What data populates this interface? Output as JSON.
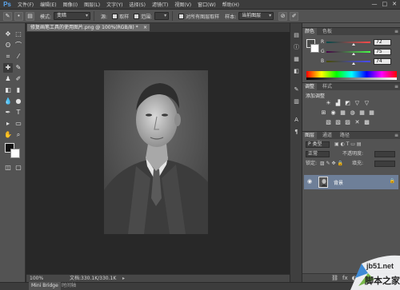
{
  "app": {
    "logo": "Ps"
  },
  "menubar": {
    "items": [
      "文件(F)",
      "编辑(E)",
      "图像(I)",
      "图层(L)",
      "文字(Y)",
      "选择(S)",
      "滤镜(T)",
      "视图(V)",
      "窗口(W)",
      "帮助(H)"
    ],
    "window_controls": [
      "—",
      "□",
      "✕"
    ]
  },
  "options": {
    "mode_label": "模式:",
    "mode_value": "变暗",
    "cancel_label": "取样",
    "range_label": "范围:",
    "protect_label": "对所有图层取样",
    "sample_label": "样本:",
    "sample_value": "当前图层"
  },
  "document": {
    "tab_title": "修复画笔工具的使用图片.png @ 100%(RGB/8) *",
    "close": "×"
  },
  "status": {
    "zoom": "100%",
    "doc_info": "文档:330.1K/330.1K"
  },
  "bottom": {
    "mini_bridge": "Mini Bridge",
    "timeline": "时间轴"
  },
  "color_panel": {
    "tabs": [
      "颜色",
      "色板"
    ],
    "menu": "≡",
    "channels": [
      {
        "label": "R",
        "value": "72",
        "fraction": 0.62
      },
      {
        "label": "G",
        "value": "75",
        "fraction": 0.62
      },
      {
        "label": "B",
        "value": "74",
        "fraction": 0.62
      }
    ]
  },
  "adjust_panel": {
    "tabs": [
      "调整",
      "样式"
    ],
    "menu": "≡",
    "title": "添加调整",
    "icons_row1": [
      "☀",
      "▟",
      "◩",
      "▽",
      "▽"
    ],
    "icons_row2": [
      "⊞",
      "◉",
      "▦",
      "◍",
      "▦",
      "▦"
    ],
    "icons_row3": [
      "▧",
      "▧",
      "▨",
      "✕",
      "▩"
    ]
  },
  "layers_panel": {
    "tabs": [
      "图层",
      "通道",
      "路径"
    ],
    "menu": "≡",
    "kind_label": "P 类型",
    "blend_value": "正常",
    "opacity_label": "不透明度:",
    "lock_label": "锁定:",
    "fill_label": "填充:",
    "layer_name": "背景",
    "eye": "◉",
    "lock": "🔒",
    "footer_icons": [
      "⛓",
      "fx",
      "◐",
      "◑",
      "▭",
      "▤",
      "🗑"
    ]
  },
  "watermark": {
    "site": "jb51.net",
    "name": "脚本之家"
  },
  "colors": {
    "accent": "#5ca6ee",
    "selected_layer": "#6e7f98"
  }
}
